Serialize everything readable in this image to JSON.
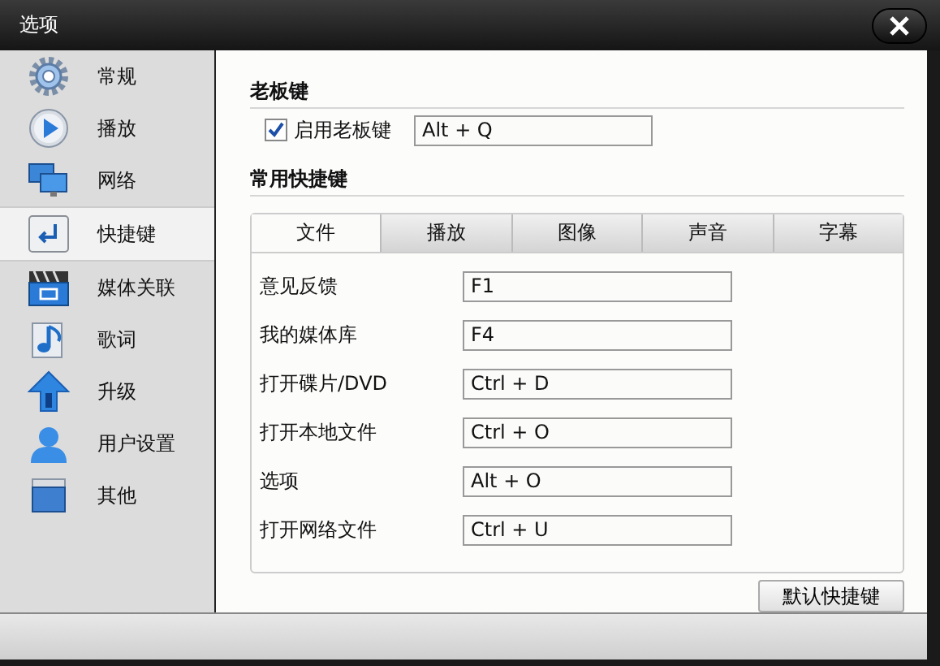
{
  "window": {
    "title": "选项"
  },
  "sidebar": {
    "items": [
      {
        "label": "常规",
        "selected": false
      },
      {
        "label": "播放",
        "selected": false
      },
      {
        "label": "网络",
        "selected": false
      },
      {
        "label": "快捷键",
        "selected": true
      },
      {
        "label": "媒体关联",
        "selected": false
      },
      {
        "label": "歌词",
        "selected": false
      },
      {
        "label": "升级",
        "selected": false
      },
      {
        "label": "用户设置",
        "selected": false
      },
      {
        "label": "其他",
        "selected": false
      }
    ]
  },
  "boss_key": {
    "heading": "老板键",
    "checkbox": {
      "label": "启用老板键",
      "checked": true
    },
    "value": "Alt + Q"
  },
  "shortcuts": {
    "heading": "常用快捷键",
    "tabs": [
      {
        "label": "文件",
        "selected": true
      },
      {
        "label": "播放",
        "selected": false
      },
      {
        "label": "图像",
        "selected": false
      },
      {
        "label": "声音",
        "selected": false
      },
      {
        "label": "字幕",
        "selected": false
      }
    ],
    "rows": [
      {
        "label": "意见反馈",
        "value": "F1"
      },
      {
        "label": "我的媒体库",
        "value": "F4"
      },
      {
        "label": "打开碟片/DVD",
        "value": "Ctrl + D"
      },
      {
        "label": "打开本地文件",
        "value": "Ctrl + O"
      },
      {
        "label": "选项",
        "value": "Alt + O"
      },
      {
        "label": "打开网络文件",
        "value": "Ctrl + U"
      }
    ],
    "default_button": "默认快捷键"
  }
}
